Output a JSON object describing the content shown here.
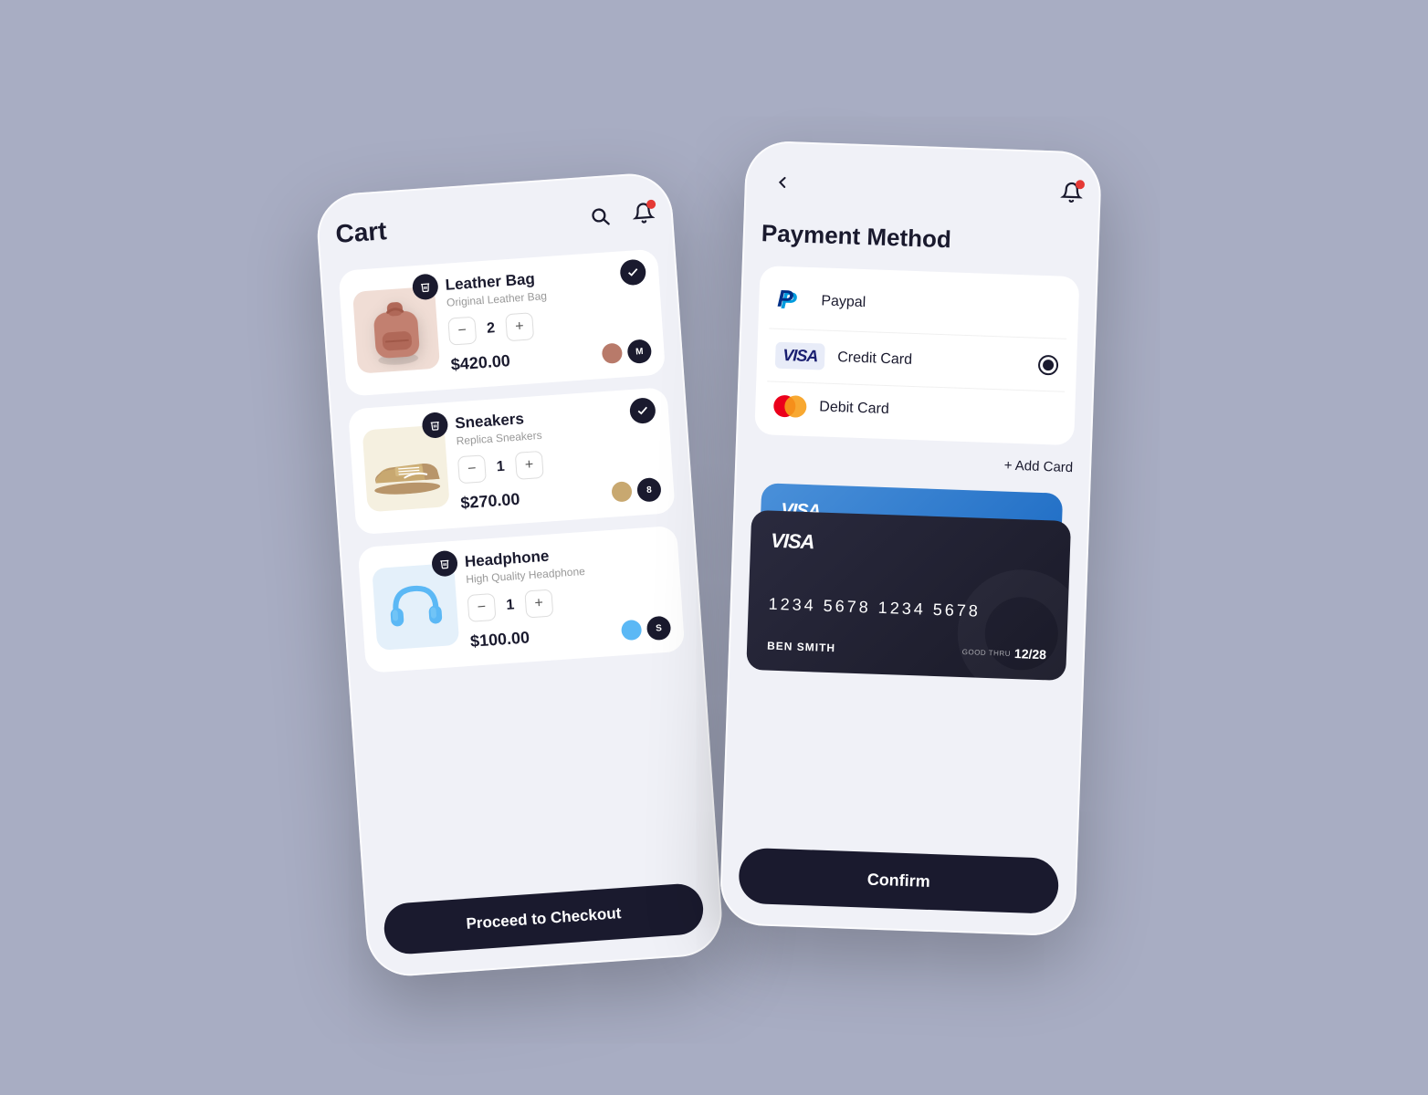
{
  "left_phone": {
    "title": "Cart",
    "items": [
      {
        "name": "Leather Bag",
        "subtitle": "Original Leather Bag",
        "quantity": 2,
        "price": "$420.00",
        "color": "#b87a6a",
        "size": "M",
        "bg_color": "#f5e8e0",
        "checked": true
      },
      {
        "name": "Sneakers",
        "subtitle": "Replica Sneakers",
        "quantity": 1,
        "price": "$270.00",
        "color": "#c8a870",
        "size": "8",
        "bg_color": "#f5f0e0",
        "checked": true
      },
      {
        "name": "Headphone",
        "subtitle": "High Quality Headphone",
        "quantity": 1,
        "price": "$100.00",
        "color": "#5bb8f5",
        "size": "S",
        "bg_color": "#e8f4fc",
        "checked": false
      }
    ],
    "checkout_btn": "Proceed to Checkout"
  },
  "right_phone": {
    "title": "Payment Method",
    "payment_options": [
      {
        "name": "Paypal",
        "type": "paypal",
        "selected": false
      },
      {
        "name": "Credit Card",
        "type": "visa",
        "selected": true
      },
      {
        "name": "Debit Card",
        "type": "mastercard",
        "selected": false
      }
    ],
    "add_card_label": "+ Add Card",
    "card": {
      "visa_label": "VISA",
      "number": "1234  5678  1234  5678",
      "holder": "BEN SMITH",
      "good_thru_label": "GOOD THRU",
      "expiry": "12/28"
    },
    "confirm_btn": "Confirm"
  }
}
